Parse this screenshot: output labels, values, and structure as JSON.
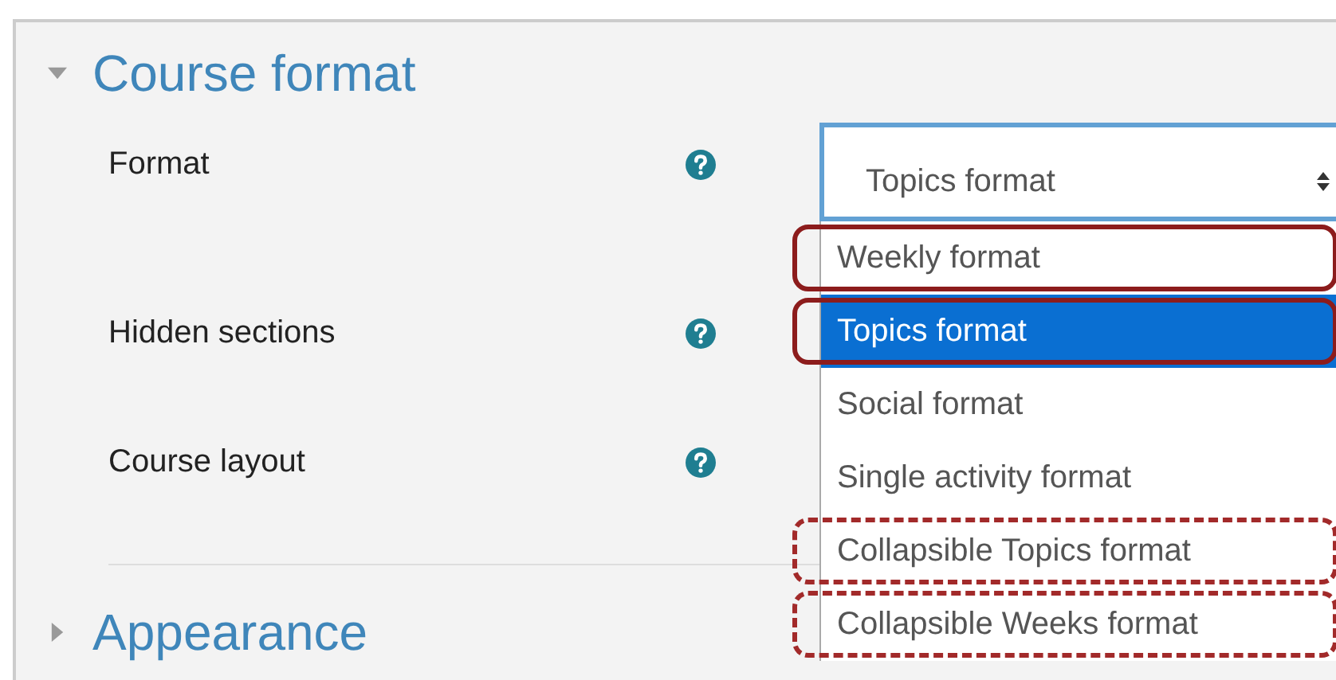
{
  "sections": [
    {
      "title": "Course format",
      "expanded": true,
      "fields": [
        {
          "label": "Format",
          "select": {
            "value": "Topics format",
            "open": true,
            "options": [
              {
                "label": "Weekly format",
                "selected": false,
                "highlighted": true,
                "dashed_outline": false
              },
              {
                "label": "Topics format",
                "selected": true,
                "highlighted": true,
                "dashed_outline": false
              },
              {
                "label": "Social format",
                "selected": false,
                "highlighted": false
              },
              {
                "label": "Single activity format",
                "selected": false,
                "highlighted": false
              },
              {
                "label": "Collapsible Topics format",
                "selected": false,
                "highlighted": true,
                "dashed_outline": true
              },
              {
                "label": "Collapsible Weeks format",
                "selected": false,
                "highlighted": true,
                "dashed_outline": true
              }
            ]
          }
        },
        {
          "label": "Hidden sections"
        },
        {
          "label": "Course layout"
        }
      ]
    },
    {
      "title": "Appearance",
      "expanded": false
    }
  ]
}
